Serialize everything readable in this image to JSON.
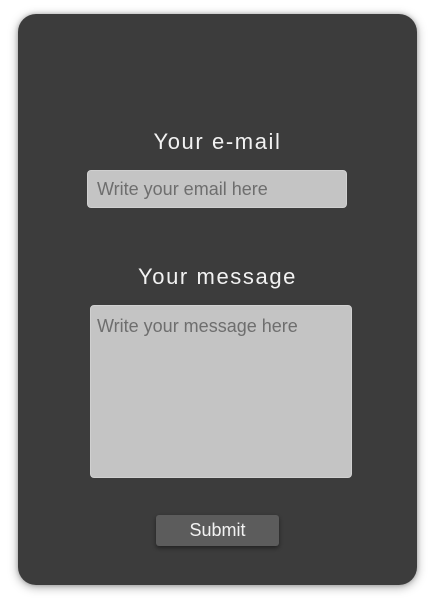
{
  "form": {
    "email_label": "Your e-mail",
    "email_placeholder": "Write your email here",
    "email_value": "",
    "message_label": "Your message",
    "message_placeholder": "Write your message here",
    "message_value": "",
    "submit_label": "Submit"
  },
  "colors": {
    "card_background": "#3c3c3c",
    "input_background": "#c4c4c4",
    "button_background": "#5c5c5c",
    "label_text": "#f2f2f2",
    "placeholder_text": "#6e6e6e"
  }
}
